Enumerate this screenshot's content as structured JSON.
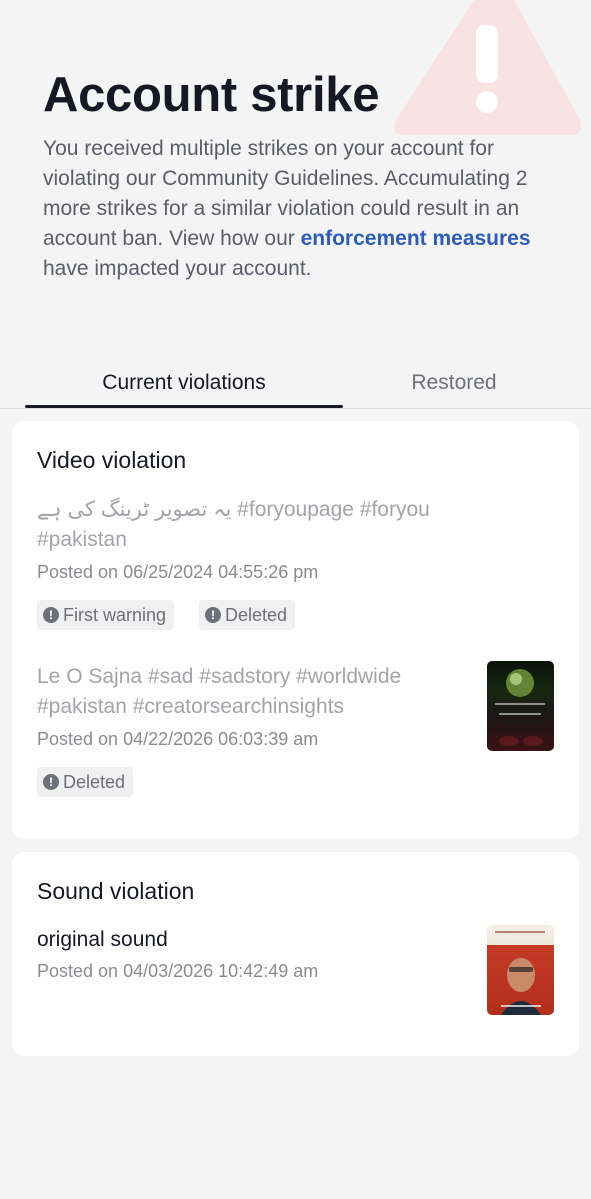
{
  "header": {
    "title": "Account strike",
    "desc_part1": "You received multiple strikes on your account for violating our Community Guidelines. Accumulating 2 more strikes for a similar violation could result in an account ban. View how our ",
    "desc_link": "enforcement measures",
    "desc_part2": " have impacted your account."
  },
  "tabs": {
    "current": "Current violations",
    "restored": "Restored"
  },
  "video_violation": {
    "title": "Video violation",
    "items": [
      {
        "text": "یہ تصویر ٹرینگ کی ہے #foryoupage #foryou #pakistan",
        "posted": "Posted on 06/25/2024 04:55:26 pm",
        "badges": [
          "First warning",
          "Deleted"
        ]
      },
      {
        "text": "Le O Sajna #sad #sadstory #worldwide #pakistan #creatorsearchinsights",
        "posted": "Posted on 04/22/2026 06:03:39 am",
        "badges": [
          "Deleted"
        ],
        "thumbnail": "video-thumbnail"
      }
    ]
  },
  "sound_violation": {
    "title": "Sound violation",
    "items": [
      {
        "text": "original sound",
        "posted": "Posted on 04/03/2026 10:42:49 am",
        "thumbnail": "sound-thumbnail"
      }
    ]
  },
  "colors": {
    "link": "#2b5db9",
    "warning_graphic": "#f7d4d4"
  }
}
